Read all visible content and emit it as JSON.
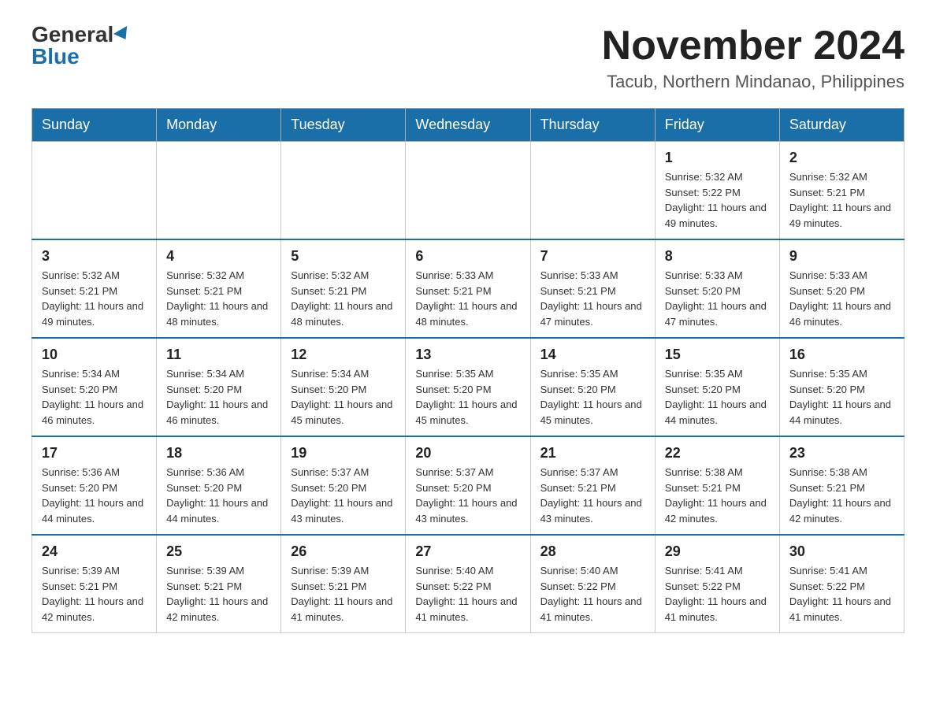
{
  "header": {
    "logo_general": "General",
    "logo_blue": "Blue",
    "month_title": "November 2024",
    "location": "Tacub, Northern Mindanao, Philippines"
  },
  "days_of_week": [
    "Sunday",
    "Monday",
    "Tuesday",
    "Wednesday",
    "Thursday",
    "Friday",
    "Saturday"
  ],
  "weeks": [
    {
      "cells": [
        {
          "empty": true
        },
        {
          "empty": true
        },
        {
          "empty": true
        },
        {
          "empty": true
        },
        {
          "empty": true
        },
        {
          "day": "1",
          "sunrise": "Sunrise: 5:32 AM",
          "sunset": "Sunset: 5:22 PM",
          "daylight": "Daylight: 11 hours and 49 minutes."
        },
        {
          "day": "2",
          "sunrise": "Sunrise: 5:32 AM",
          "sunset": "Sunset: 5:21 PM",
          "daylight": "Daylight: 11 hours and 49 minutes."
        }
      ]
    },
    {
      "cells": [
        {
          "day": "3",
          "sunrise": "Sunrise: 5:32 AM",
          "sunset": "Sunset: 5:21 PM",
          "daylight": "Daylight: 11 hours and 49 minutes."
        },
        {
          "day": "4",
          "sunrise": "Sunrise: 5:32 AM",
          "sunset": "Sunset: 5:21 PM",
          "daylight": "Daylight: 11 hours and 48 minutes."
        },
        {
          "day": "5",
          "sunrise": "Sunrise: 5:32 AM",
          "sunset": "Sunset: 5:21 PM",
          "daylight": "Daylight: 11 hours and 48 minutes."
        },
        {
          "day": "6",
          "sunrise": "Sunrise: 5:33 AM",
          "sunset": "Sunset: 5:21 PM",
          "daylight": "Daylight: 11 hours and 48 minutes."
        },
        {
          "day": "7",
          "sunrise": "Sunrise: 5:33 AM",
          "sunset": "Sunset: 5:21 PM",
          "daylight": "Daylight: 11 hours and 47 minutes."
        },
        {
          "day": "8",
          "sunrise": "Sunrise: 5:33 AM",
          "sunset": "Sunset: 5:20 PM",
          "daylight": "Daylight: 11 hours and 47 minutes."
        },
        {
          "day": "9",
          "sunrise": "Sunrise: 5:33 AM",
          "sunset": "Sunset: 5:20 PM",
          "daylight": "Daylight: 11 hours and 46 minutes."
        }
      ]
    },
    {
      "cells": [
        {
          "day": "10",
          "sunrise": "Sunrise: 5:34 AM",
          "sunset": "Sunset: 5:20 PM",
          "daylight": "Daylight: 11 hours and 46 minutes."
        },
        {
          "day": "11",
          "sunrise": "Sunrise: 5:34 AM",
          "sunset": "Sunset: 5:20 PM",
          "daylight": "Daylight: 11 hours and 46 minutes."
        },
        {
          "day": "12",
          "sunrise": "Sunrise: 5:34 AM",
          "sunset": "Sunset: 5:20 PM",
          "daylight": "Daylight: 11 hours and 45 minutes."
        },
        {
          "day": "13",
          "sunrise": "Sunrise: 5:35 AM",
          "sunset": "Sunset: 5:20 PM",
          "daylight": "Daylight: 11 hours and 45 minutes."
        },
        {
          "day": "14",
          "sunrise": "Sunrise: 5:35 AM",
          "sunset": "Sunset: 5:20 PM",
          "daylight": "Daylight: 11 hours and 45 minutes."
        },
        {
          "day": "15",
          "sunrise": "Sunrise: 5:35 AM",
          "sunset": "Sunset: 5:20 PM",
          "daylight": "Daylight: 11 hours and 44 minutes."
        },
        {
          "day": "16",
          "sunrise": "Sunrise: 5:35 AM",
          "sunset": "Sunset: 5:20 PM",
          "daylight": "Daylight: 11 hours and 44 minutes."
        }
      ]
    },
    {
      "cells": [
        {
          "day": "17",
          "sunrise": "Sunrise: 5:36 AM",
          "sunset": "Sunset: 5:20 PM",
          "daylight": "Daylight: 11 hours and 44 minutes."
        },
        {
          "day": "18",
          "sunrise": "Sunrise: 5:36 AM",
          "sunset": "Sunset: 5:20 PM",
          "daylight": "Daylight: 11 hours and 44 minutes."
        },
        {
          "day": "19",
          "sunrise": "Sunrise: 5:37 AM",
          "sunset": "Sunset: 5:20 PM",
          "daylight": "Daylight: 11 hours and 43 minutes."
        },
        {
          "day": "20",
          "sunrise": "Sunrise: 5:37 AM",
          "sunset": "Sunset: 5:20 PM",
          "daylight": "Daylight: 11 hours and 43 minutes."
        },
        {
          "day": "21",
          "sunrise": "Sunrise: 5:37 AM",
          "sunset": "Sunset: 5:21 PM",
          "daylight": "Daylight: 11 hours and 43 minutes."
        },
        {
          "day": "22",
          "sunrise": "Sunrise: 5:38 AM",
          "sunset": "Sunset: 5:21 PM",
          "daylight": "Daylight: 11 hours and 42 minutes."
        },
        {
          "day": "23",
          "sunrise": "Sunrise: 5:38 AM",
          "sunset": "Sunset: 5:21 PM",
          "daylight": "Daylight: 11 hours and 42 minutes."
        }
      ]
    },
    {
      "cells": [
        {
          "day": "24",
          "sunrise": "Sunrise: 5:39 AM",
          "sunset": "Sunset: 5:21 PM",
          "daylight": "Daylight: 11 hours and 42 minutes."
        },
        {
          "day": "25",
          "sunrise": "Sunrise: 5:39 AM",
          "sunset": "Sunset: 5:21 PM",
          "daylight": "Daylight: 11 hours and 42 minutes."
        },
        {
          "day": "26",
          "sunrise": "Sunrise: 5:39 AM",
          "sunset": "Sunset: 5:21 PM",
          "daylight": "Daylight: 11 hours and 41 minutes."
        },
        {
          "day": "27",
          "sunrise": "Sunrise: 5:40 AM",
          "sunset": "Sunset: 5:22 PM",
          "daylight": "Daylight: 11 hours and 41 minutes."
        },
        {
          "day": "28",
          "sunrise": "Sunrise: 5:40 AM",
          "sunset": "Sunset: 5:22 PM",
          "daylight": "Daylight: 11 hours and 41 minutes."
        },
        {
          "day": "29",
          "sunrise": "Sunrise: 5:41 AM",
          "sunset": "Sunset: 5:22 PM",
          "daylight": "Daylight: 11 hours and 41 minutes."
        },
        {
          "day": "30",
          "sunrise": "Sunrise: 5:41 AM",
          "sunset": "Sunset: 5:22 PM",
          "daylight": "Daylight: 11 hours and 41 minutes."
        }
      ]
    }
  ]
}
